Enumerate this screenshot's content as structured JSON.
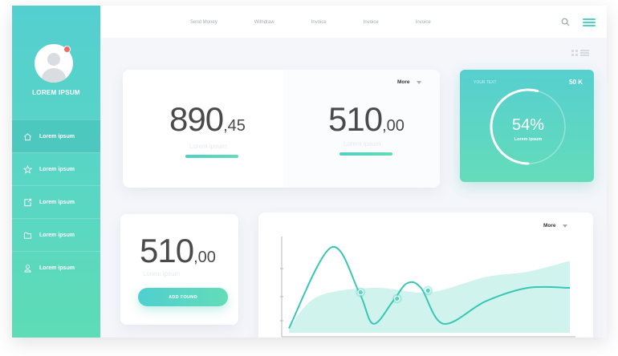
{
  "sidebar": {
    "profile_name": "LOREM IPSUM",
    "items": [
      {
        "label": "Lorem ipsum",
        "icon": "home-icon"
      },
      {
        "label": "Lorem ipsum",
        "icon": "star-icon"
      },
      {
        "label": "Lorem ipsum",
        "icon": "export-icon"
      },
      {
        "label": "Lorem ipsum",
        "icon": "folder-icon"
      },
      {
        "label": "Lorem ipsum",
        "icon": "user-icon"
      }
    ]
  },
  "topnav": [
    "Send Money",
    "Withdraw",
    "Invoice",
    "Invoice",
    "Invoice"
  ],
  "stats": {
    "more_label": "More",
    "a": {
      "int": "890",
      "dec": ",45",
      "caption": "Lorem ipsum"
    },
    "b": {
      "int": "510",
      "dec": ",00",
      "caption": "Lorem ipsum"
    }
  },
  "progress_card": {
    "title": "YOUR TEXT",
    "value": "50 K",
    "percent_label": "54%",
    "percent": 54,
    "label": "Lorem ipsum"
  },
  "small_card": {
    "int": "510",
    "dec": ",00",
    "caption": "Lorem ipsum",
    "button_label": "ADD FOUND"
  },
  "chart": {
    "more_label": "More"
  },
  "chart_data": {
    "type": "line",
    "title": "",
    "xlabel": "",
    "ylabel": "",
    "series": [
      {
        "kind": "line",
        "points": [
          [
            0,
            0.05
          ],
          [
            0.15,
            0.95
          ],
          [
            0.25,
            0.45
          ],
          [
            0.3,
            0.1
          ],
          [
            0.37,
            0.35
          ],
          [
            0.42,
            0.55
          ],
          [
            0.47,
            0.5
          ],
          [
            0.55,
            0.1
          ],
          [
            0.7,
            0.35
          ],
          [
            0.85,
            0.5
          ],
          [
            1,
            0.5
          ]
        ]
      },
      {
        "kind": "area",
        "points": [
          [
            0,
            0.05
          ],
          [
            0.1,
            0.4
          ],
          [
            0.3,
            0.5
          ],
          [
            0.5,
            0.45
          ],
          [
            0.7,
            0.62
          ],
          [
            0.85,
            0.68
          ],
          [
            1,
            0.8
          ]
        ]
      }
    ],
    "markers": [
      [
        0.255,
        0.45
      ],
      [
        0.385,
        0.38
      ],
      [
        0.495,
        0.47
      ]
    ],
    "colors": {
      "line": "#38c7b4",
      "area": "#c8f1eb",
      "marker": "#4fd8c3"
    }
  },
  "colors": {
    "accent": "#54cfd0",
    "accent2": "#63dcb8",
    "notification": "#f06a6a"
  }
}
